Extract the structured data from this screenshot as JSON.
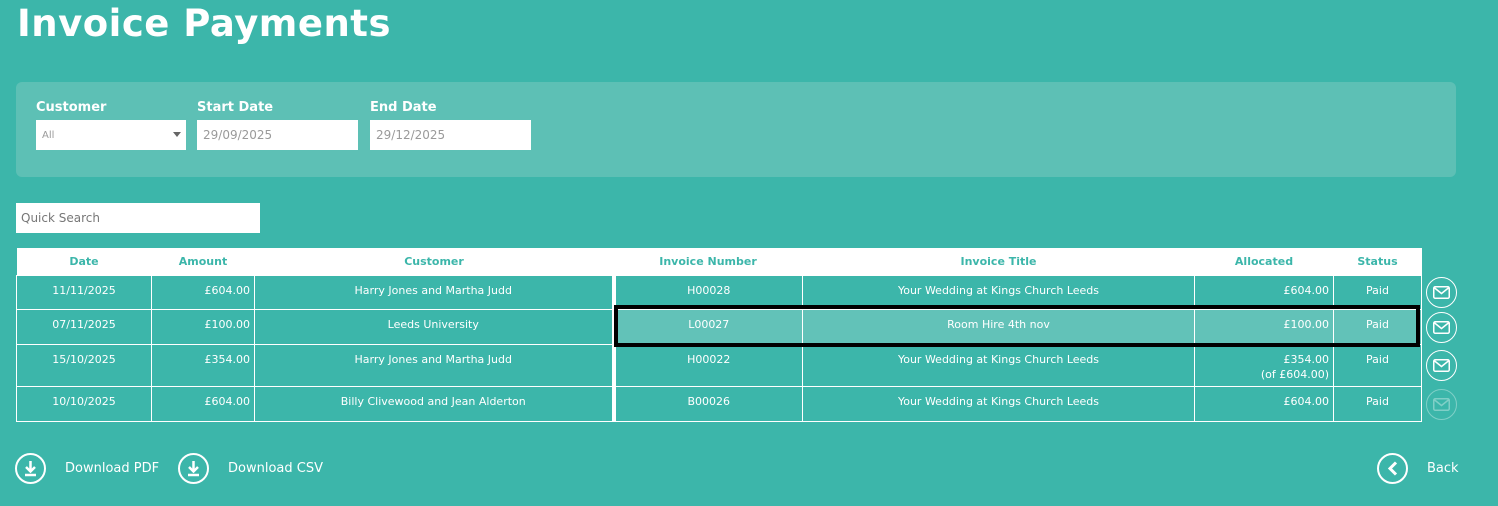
{
  "page": {
    "title": "Invoice Payments"
  },
  "filters": {
    "customer": {
      "label": "Customer",
      "value": "All"
    },
    "start_date": {
      "label": "Start Date",
      "value": "29/09/2025"
    },
    "end_date": {
      "label": "End Date",
      "value": "29/12/2025"
    }
  },
  "search": {
    "placeholder": "Quick Search"
  },
  "table": {
    "headers": [
      "Date",
      "Amount",
      "Customer",
      "Invoice Number",
      "Invoice Title",
      "Allocated",
      "Status"
    ],
    "rows": [
      {
        "date": "11/11/2025",
        "amount": "£604.00",
        "customer": "Harry Jones and Martha Judd",
        "invoice_number": "H00028",
        "invoice_title": "Your Wedding at Kings Church Leeds",
        "allocated": "£604.00",
        "allocated_note": "",
        "status": "Paid"
      },
      {
        "date": "07/11/2025",
        "amount": "£100.00",
        "customer": "Leeds University",
        "invoice_number": "L00027",
        "invoice_title": "Room Hire 4th nov",
        "allocated": "£100.00",
        "allocated_note": "",
        "status": "Paid"
      },
      {
        "date": "15/10/2025",
        "amount": "£354.00",
        "customer": "Harry Jones and Martha Judd",
        "invoice_number": "H00022",
        "invoice_title": "Your Wedding at Kings Church Leeds",
        "allocated": "£354.00",
        "allocated_note": "(of £604.00)",
        "status": "Paid"
      },
      {
        "date": "10/10/2025",
        "amount": "£604.00",
        "customer": "Billy Clivewood and Jean Alderton",
        "invoice_number": "B00026",
        "invoice_title": "Your Wedding at Kings Church Leeds",
        "allocated": "£604.00",
        "allocated_note": "",
        "status": "Paid"
      }
    ]
  },
  "footer": {
    "download_pdf": "Download PDF",
    "download_csv": "Download CSV",
    "back": "Back"
  },
  "icons": {
    "mail": "envelope-icon",
    "download": "download-icon",
    "back": "chevron-left-icon"
  },
  "colors": {
    "background": "#3cb6aa",
    "panel": "#5dc0b5",
    "highlight": "#62c2b8"
  }
}
